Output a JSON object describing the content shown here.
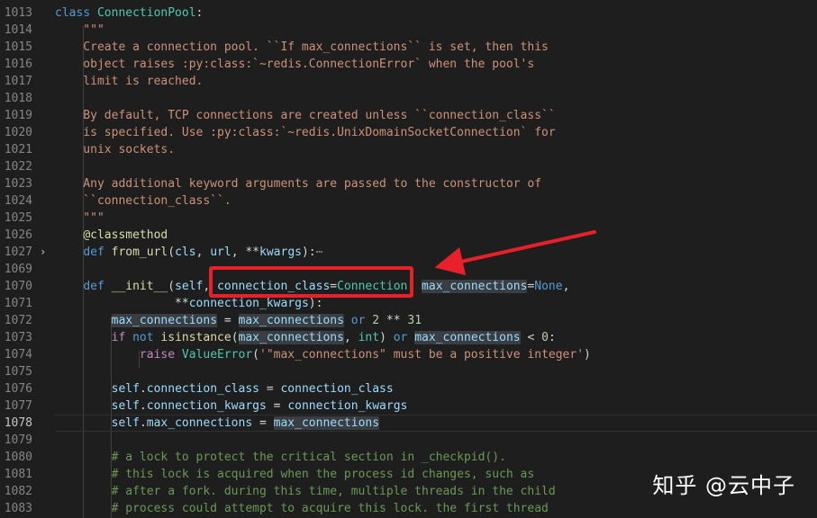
{
  "editor": {
    "language": "python",
    "active_line": "1078",
    "folded_line": "1027",
    "lines": [
      {
        "num": "1013",
        "tokens": [
          [
            "kw",
            "class "
          ],
          [
            "cls",
            "ConnectionPool"
          ],
          [
            "op",
            ":"
          ]
        ]
      },
      {
        "num": "1014",
        "tokens": [
          [
            "doc",
            "    \"\"\""
          ]
        ]
      },
      {
        "num": "1015",
        "tokens": [
          [
            "doc",
            "    Create a connection pool. ``If max_connections`` is set, then this"
          ]
        ]
      },
      {
        "num": "1016",
        "tokens": [
          [
            "doc",
            "    object raises :py:class:`~redis.ConnectionError` when the pool's"
          ]
        ]
      },
      {
        "num": "1017",
        "tokens": [
          [
            "doc",
            "    limit is reached."
          ]
        ]
      },
      {
        "num": "1018",
        "tokens": []
      },
      {
        "num": "1019",
        "tokens": [
          [
            "doc",
            "    By default, TCP connections are created unless ``connection_class``"
          ]
        ]
      },
      {
        "num": "1020",
        "tokens": [
          [
            "doc",
            "    is specified. Use :py:class:`~redis.UnixDomainSocketConnection` for"
          ]
        ]
      },
      {
        "num": "1021",
        "tokens": [
          [
            "doc",
            "    unix sockets."
          ]
        ]
      },
      {
        "num": "1022",
        "tokens": []
      },
      {
        "num": "1023",
        "tokens": [
          [
            "doc",
            "    Any additional keyword arguments are passed to the constructor of"
          ]
        ]
      },
      {
        "num": "1024",
        "tokens": [
          [
            "doc",
            "    ``connection_class``."
          ]
        ]
      },
      {
        "num": "1025",
        "tokens": [
          [
            "doc",
            "    \"\"\""
          ]
        ]
      },
      {
        "num": "1026",
        "tokens": [
          [
            "op",
            "    "
          ],
          [
            "dec",
            "@classmethod"
          ]
        ]
      },
      {
        "num": "1027",
        "tokens": [
          [
            "op",
            "    "
          ],
          [
            "kw",
            "def "
          ],
          [
            "fn",
            "from_url"
          ],
          [
            "op",
            "("
          ],
          [
            "par",
            "cls"
          ],
          [
            "op",
            ", "
          ],
          [
            "par",
            "url"
          ],
          [
            "op",
            ", **"
          ],
          [
            "par",
            "kwargs"
          ],
          [
            "op",
            "):"
          ],
          [
            "fold-ellipsis",
            "⋯"
          ]
        ]
      },
      {
        "num": "1069",
        "tokens": []
      },
      {
        "num": "1070",
        "tokens": [
          [
            "op",
            "    "
          ],
          [
            "kw",
            "def "
          ],
          [
            "fn",
            "__init__"
          ],
          [
            "op",
            "("
          ],
          [
            "par",
            "self"
          ],
          [
            "op",
            ", "
          ],
          [
            "par",
            "connection_class"
          ],
          [
            "op",
            "="
          ],
          [
            "cls",
            "Connection"
          ],
          [
            "op",
            ", "
          ],
          [
            "par hl",
            "max_connections"
          ],
          [
            "op",
            "="
          ],
          [
            "kw",
            "None"
          ],
          [
            "op",
            ","
          ]
        ]
      },
      {
        "num": "1071",
        "tokens": [
          [
            "op",
            "                 **"
          ],
          [
            "par",
            "connection_kwargs"
          ],
          [
            "op",
            "):"
          ]
        ]
      },
      {
        "num": "1072",
        "tokens": [
          [
            "op",
            "        "
          ],
          [
            "par hl",
            "max_connections"
          ],
          [
            "op",
            " = "
          ],
          [
            "par hl",
            "max_connections"
          ],
          [
            "op",
            " "
          ],
          [
            "kw",
            "or"
          ],
          [
            "op",
            " "
          ],
          [
            "num",
            "2"
          ],
          [
            "op",
            " ** "
          ],
          [
            "num",
            "31"
          ]
        ]
      },
      {
        "num": "1073",
        "tokens": [
          [
            "op",
            "        "
          ],
          [
            "kw2",
            "if "
          ],
          [
            "kw",
            "not "
          ],
          [
            "fn",
            "isinstance"
          ],
          [
            "op",
            "("
          ],
          [
            "par hl",
            "max_connections"
          ],
          [
            "op",
            ", "
          ],
          [
            "cls",
            "int"
          ],
          [
            "op",
            ") "
          ],
          [
            "kw",
            "or "
          ],
          [
            "par hl",
            "max_connections"
          ],
          [
            "op",
            " < "
          ],
          [
            "num",
            "0"
          ],
          [
            "op",
            ":"
          ]
        ]
      },
      {
        "num": "1074",
        "tokens": [
          [
            "op",
            "            "
          ],
          [
            "kw2",
            "raise "
          ],
          [
            "cls",
            "ValueError"
          ],
          [
            "op",
            "("
          ],
          [
            "str",
            "'\"max_connections\" must be a positive integer'"
          ],
          [
            "op",
            ")"
          ]
        ]
      },
      {
        "num": "1075",
        "tokens": []
      },
      {
        "num": "1076",
        "tokens": [
          [
            "op",
            "        "
          ],
          [
            "par",
            "self"
          ],
          [
            "op",
            "."
          ],
          [
            "par",
            "connection_class"
          ],
          [
            "op",
            " = "
          ],
          [
            "par",
            "connection_class"
          ]
        ]
      },
      {
        "num": "1077",
        "tokens": [
          [
            "op",
            "        "
          ],
          [
            "par",
            "self"
          ],
          [
            "op",
            "."
          ],
          [
            "par",
            "connection_kwargs"
          ],
          [
            "op",
            " = "
          ],
          [
            "par",
            "connection_kwargs"
          ]
        ]
      },
      {
        "num": "1078",
        "tokens": [
          [
            "op",
            "        "
          ],
          [
            "par",
            "self"
          ],
          [
            "op",
            "."
          ],
          [
            "par",
            "max_connections"
          ],
          [
            "op",
            " = "
          ],
          [
            "par hl",
            "max_connections"
          ]
        ]
      },
      {
        "num": "1079",
        "tokens": []
      },
      {
        "num": "1080",
        "tokens": [
          [
            "cm",
            "        # a lock to protect the critical section in _checkpid()."
          ]
        ]
      },
      {
        "num": "1081",
        "tokens": [
          [
            "cm",
            "        # this lock is acquired when the process id changes, such as"
          ]
        ]
      },
      {
        "num": "1082",
        "tokens": [
          [
            "cm",
            "        # after a fork. during this time, multiple threads in the child"
          ]
        ]
      },
      {
        "num": "1083",
        "tokens": [
          [
            "cm",
            "        # process could attempt to acquire this lock. the first thread"
          ]
        ]
      }
    ]
  },
  "annotation": {
    "box_color": "#e8202a",
    "arrow_color": "#e8202a"
  },
  "watermark": {
    "text": "知乎 @云中子"
  }
}
